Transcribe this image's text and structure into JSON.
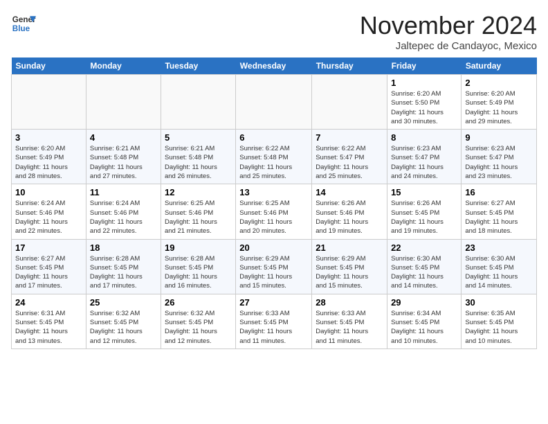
{
  "logo": {
    "line1": "General",
    "line2": "Blue"
  },
  "title": "November 2024",
  "location": "Jaltepec de Candayoc, Mexico",
  "weekdays": [
    "Sunday",
    "Monday",
    "Tuesday",
    "Wednesday",
    "Thursday",
    "Friday",
    "Saturday"
  ],
  "weeks": [
    [
      {
        "day": "",
        "info": ""
      },
      {
        "day": "",
        "info": ""
      },
      {
        "day": "",
        "info": ""
      },
      {
        "day": "",
        "info": ""
      },
      {
        "day": "",
        "info": ""
      },
      {
        "day": "1",
        "info": "Sunrise: 6:20 AM\nSunset: 5:50 PM\nDaylight: 11 hours\nand 30 minutes."
      },
      {
        "day": "2",
        "info": "Sunrise: 6:20 AM\nSunset: 5:49 PM\nDaylight: 11 hours\nand 29 minutes."
      }
    ],
    [
      {
        "day": "3",
        "info": "Sunrise: 6:20 AM\nSunset: 5:49 PM\nDaylight: 11 hours\nand 28 minutes."
      },
      {
        "day": "4",
        "info": "Sunrise: 6:21 AM\nSunset: 5:48 PM\nDaylight: 11 hours\nand 27 minutes."
      },
      {
        "day": "5",
        "info": "Sunrise: 6:21 AM\nSunset: 5:48 PM\nDaylight: 11 hours\nand 26 minutes."
      },
      {
        "day": "6",
        "info": "Sunrise: 6:22 AM\nSunset: 5:48 PM\nDaylight: 11 hours\nand 25 minutes."
      },
      {
        "day": "7",
        "info": "Sunrise: 6:22 AM\nSunset: 5:47 PM\nDaylight: 11 hours\nand 25 minutes."
      },
      {
        "day": "8",
        "info": "Sunrise: 6:23 AM\nSunset: 5:47 PM\nDaylight: 11 hours\nand 24 minutes."
      },
      {
        "day": "9",
        "info": "Sunrise: 6:23 AM\nSunset: 5:47 PM\nDaylight: 11 hours\nand 23 minutes."
      }
    ],
    [
      {
        "day": "10",
        "info": "Sunrise: 6:24 AM\nSunset: 5:46 PM\nDaylight: 11 hours\nand 22 minutes."
      },
      {
        "day": "11",
        "info": "Sunrise: 6:24 AM\nSunset: 5:46 PM\nDaylight: 11 hours\nand 22 minutes."
      },
      {
        "day": "12",
        "info": "Sunrise: 6:25 AM\nSunset: 5:46 PM\nDaylight: 11 hours\nand 21 minutes."
      },
      {
        "day": "13",
        "info": "Sunrise: 6:25 AM\nSunset: 5:46 PM\nDaylight: 11 hours\nand 20 minutes."
      },
      {
        "day": "14",
        "info": "Sunrise: 6:26 AM\nSunset: 5:46 PM\nDaylight: 11 hours\nand 19 minutes."
      },
      {
        "day": "15",
        "info": "Sunrise: 6:26 AM\nSunset: 5:45 PM\nDaylight: 11 hours\nand 19 minutes."
      },
      {
        "day": "16",
        "info": "Sunrise: 6:27 AM\nSunset: 5:45 PM\nDaylight: 11 hours\nand 18 minutes."
      }
    ],
    [
      {
        "day": "17",
        "info": "Sunrise: 6:27 AM\nSunset: 5:45 PM\nDaylight: 11 hours\nand 17 minutes."
      },
      {
        "day": "18",
        "info": "Sunrise: 6:28 AM\nSunset: 5:45 PM\nDaylight: 11 hours\nand 17 minutes."
      },
      {
        "day": "19",
        "info": "Sunrise: 6:28 AM\nSunset: 5:45 PM\nDaylight: 11 hours\nand 16 minutes."
      },
      {
        "day": "20",
        "info": "Sunrise: 6:29 AM\nSunset: 5:45 PM\nDaylight: 11 hours\nand 15 minutes."
      },
      {
        "day": "21",
        "info": "Sunrise: 6:29 AM\nSunset: 5:45 PM\nDaylight: 11 hours\nand 15 minutes."
      },
      {
        "day": "22",
        "info": "Sunrise: 6:30 AM\nSunset: 5:45 PM\nDaylight: 11 hours\nand 14 minutes."
      },
      {
        "day": "23",
        "info": "Sunrise: 6:30 AM\nSunset: 5:45 PM\nDaylight: 11 hours\nand 14 minutes."
      }
    ],
    [
      {
        "day": "24",
        "info": "Sunrise: 6:31 AM\nSunset: 5:45 PM\nDaylight: 11 hours\nand 13 minutes."
      },
      {
        "day": "25",
        "info": "Sunrise: 6:32 AM\nSunset: 5:45 PM\nDaylight: 11 hours\nand 12 minutes."
      },
      {
        "day": "26",
        "info": "Sunrise: 6:32 AM\nSunset: 5:45 PM\nDaylight: 11 hours\nand 12 minutes."
      },
      {
        "day": "27",
        "info": "Sunrise: 6:33 AM\nSunset: 5:45 PM\nDaylight: 11 hours\nand 11 minutes."
      },
      {
        "day": "28",
        "info": "Sunrise: 6:33 AM\nSunset: 5:45 PM\nDaylight: 11 hours\nand 11 minutes."
      },
      {
        "day": "29",
        "info": "Sunrise: 6:34 AM\nSunset: 5:45 PM\nDaylight: 11 hours\nand 10 minutes."
      },
      {
        "day": "30",
        "info": "Sunrise: 6:35 AM\nSunset: 5:45 PM\nDaylight: 11 hours\nand 10 minutes."
      }
    ]
  ]
}
